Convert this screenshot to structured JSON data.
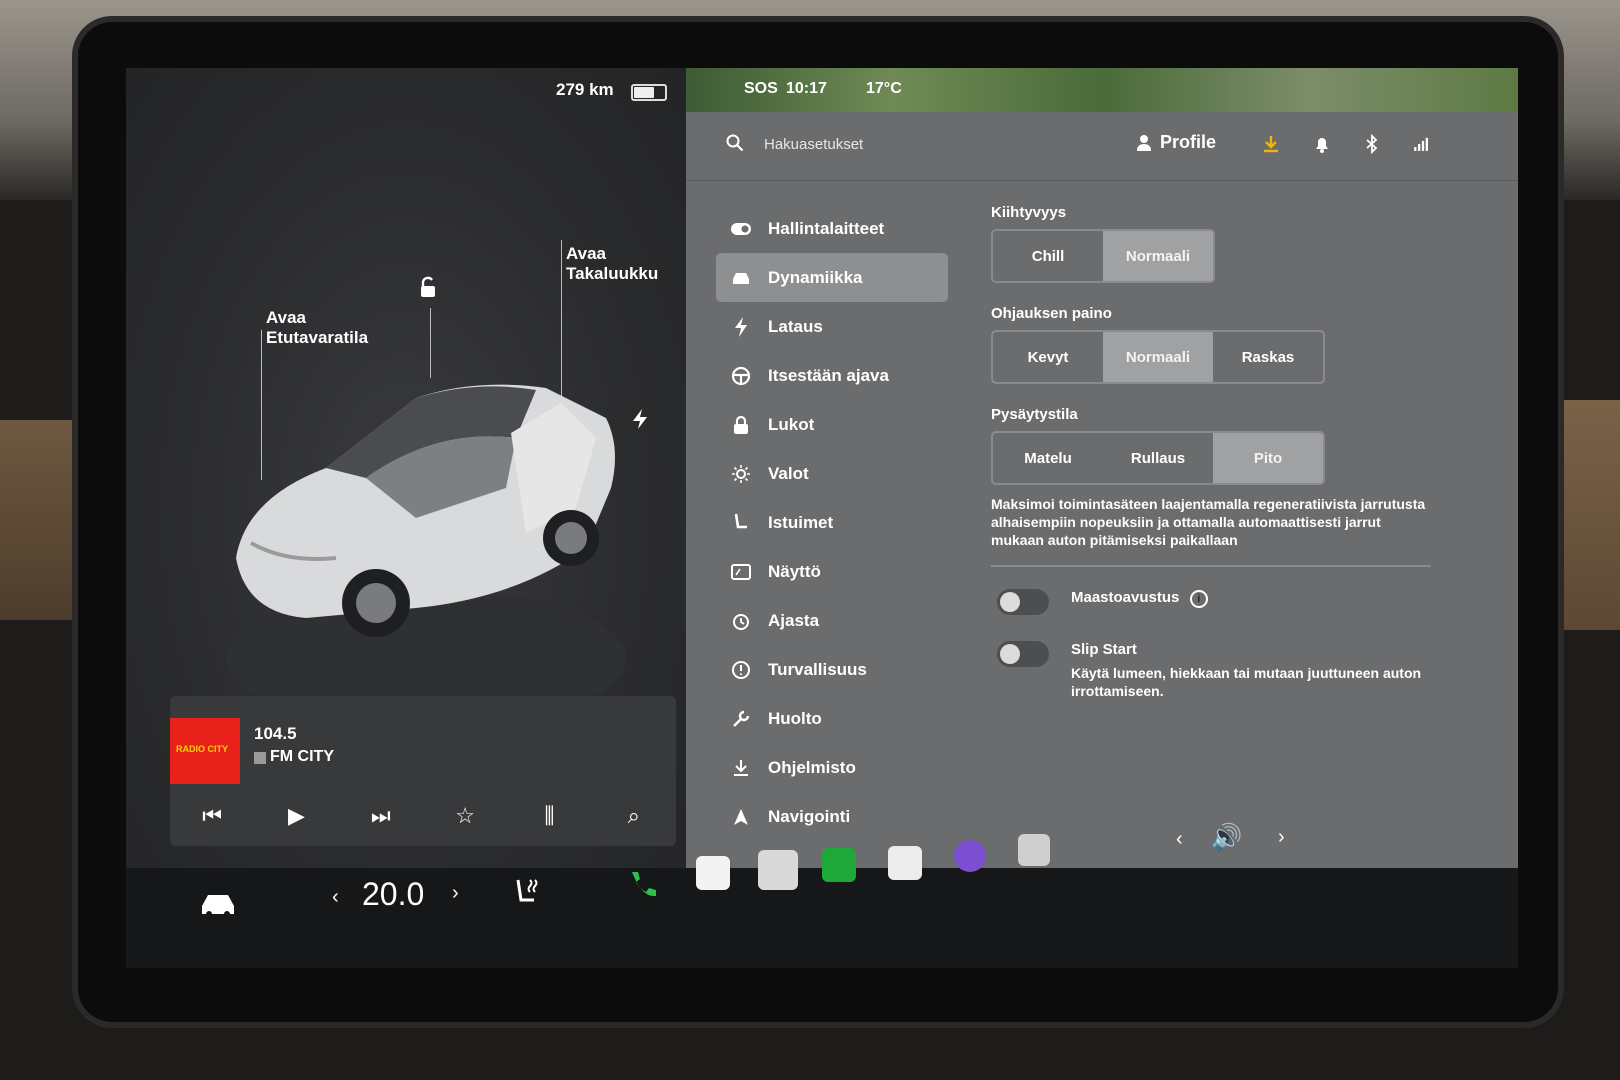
{
  "status": {
    "range": "279 km",
    "time": "10:17",
    "sos": "SOS",
    "temperature": "17°C"
  },
  "vehicle": {
    "frunk_label": "Avaa\nEtutavaratila",
    "trunk_label": "Avaa\nTakaluukku"
  },
  "media": {
    "frequency": "104.5",
    "station": "FM CITY",
    "album_text": "RADIO CITY",
    "controls": [
      "previous",
      "play",
      "next",
      "favorite",
      "equalizer",
      "search"
    ]
  },
  "search": {
    "placeholder": "Hakuasetukset"
  },
  "header": {
    "profile_label": "Profile"
  },
  "nav": {
    "items": [
      {
        "label": "Hallintalaitteet",
        "icon": "toggle-icon"
      },
      {
        "label": "Dynamiikka",
        "icon": "car-icon",
        "active": true
      },
      {
        "label": "Lataus",
        "icon": "bolt-icon"
      },
      {
        "label": "Itsestään ajava",
        "icon": "steering-wheel-icon"
      },
      {
        "label": "Lukot",
        "icon": "lock-icon"
      },
      {
        "label": "Valot",
        "icon": "sun-icon"
      },
      {
        "label": "Istuimet",
        "icon": "seat-icon"
      },
      {
        "label": "Näyttö",
        "icon": "display-icon"
      },
      {
        "label": "Ajasta",
        "icon": "alarm-icon"
      },
      {
        "label": "Turvallisuus",
        "icon": "alert-icon"
      },
      {
        "label": "Huolto",
        "icon": "wrench-icon"
      },
      {
        "label": "Ohjelmisto",
        "icon": "download-icon"
      },
      {
        "label": "Navigointi",
        "icon": "navigation-icon"
      }
    ]
  },
  "settings": {
    "acceleration": {
      "title": "Kiihtyvyys",
      "options": [
        "Chill",
        "Normaali"
      ],
      "selected": "Normaali"
    },
    "steering": {
      "title": "Ohjauksen paino",
      "options": [
        "Kevyt",
        "Normaali",
        "Raskas"
      ],
      "selected": "Normaali"
    },
    "stopping": {
      "title": "Pysäytystila",
      "options": [
        "Matelu",
        "Rullaus",
        "Pito"
      ],
      "selected": "Pito",
      "description": "Maksimoi toimintasäteen laajentamalla regeneratiivista jarrutusta alhaisempiin nopeuksiin ja ottamalla automaattisesti jarrut mukaan auton pitämiseksi paikallaan"
    },
    "offroad": {
      "label": "Maastoavustus",
      "enabled": false
    },
    "slip_start": {
      "label": "Slip Start",
      "description": "Käytä lumeen, hiekkaan tai mutaan juuttuneen auton irrottamiseen.",
      "enabled": false
    }
  },
  "climate": {
    "temperature": "20.0"
  },
  "colors": {
    "accent_download": "#f2b705",
    "phone_green": "#2dbf4a",
    "radio_red": "#e8211a"
  }
}
